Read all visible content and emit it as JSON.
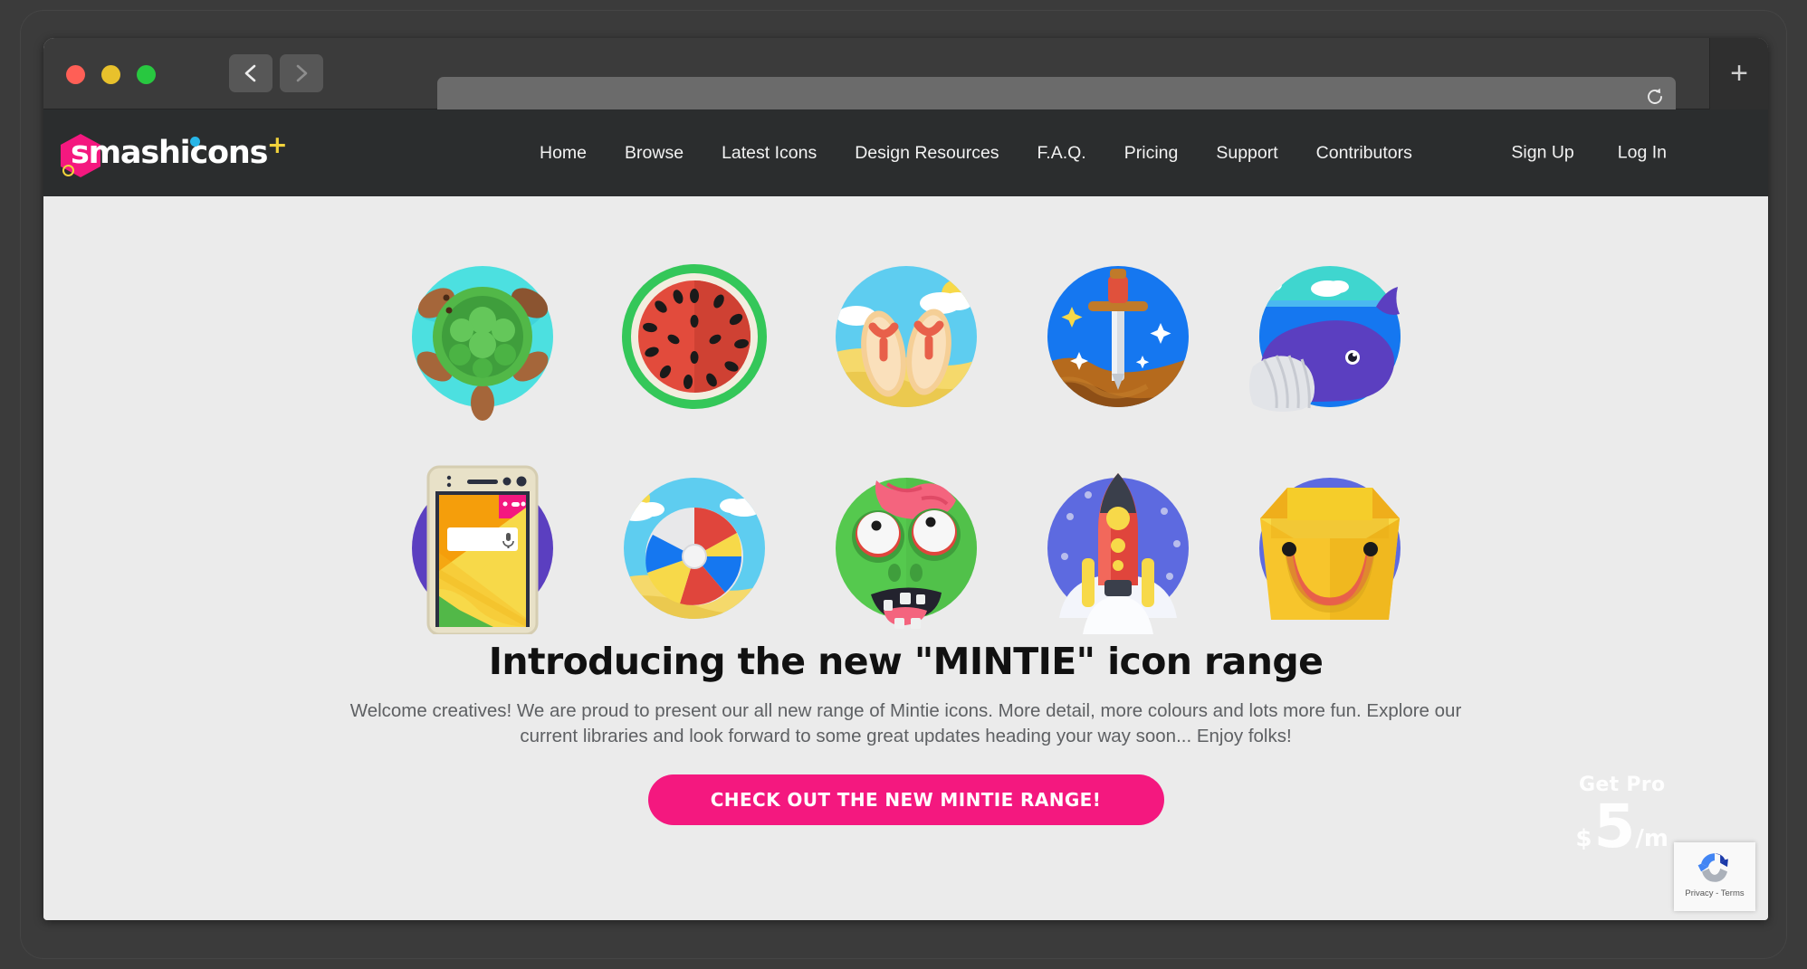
{
  "browser": {
    "traffic_lights": [
      {
        "name": "close",
        "color": "#ff5f56"
      },
      {
        "name": "minimize",
        "color": "#e8c12c"
      },
      {
        "name": "maximize",
        "color": "#28c840"
      }
    ],
    "back_icon": "chevron-left-icon",
    "forward_icon": "chevron-right-icon",
    "reload_icon": "reload-icon",
    "newtab_label": "+",
    "url_value": "",
    "url_placeholder": ""
  },
  "header": {
    "logo": {
      "word": "smashicons",
      "plus": "+"
    },
    "nav": [
      {
        "label": "Home"
      },
      {
        "label": "Browse"
      },
      {
        "label": "Latest Icons"
      },
      {
        "label": "Design Resources"
      },
      {
        "label": "F.A.Q."
      },
      {
        "label": "Pricing"
      },
      {
        "label": "Support"
      },
      {
        "label": "Contributors"
      }
    ],
    "auth": [
      {
        "label": "Sign Up"
      },
      {
        "label": "Log In"
      }
    ]
  },
  "icons": [
    {
      "name": "turtle-icon",
      "label": "Turtle"
    },
    {
      "name": "watermelon-icon",
      "label": "Watermelon"
    },
    {
      "name": "flip-flops-icon",
      "label": "Flip Flops"
    },
    {
      "name": "sword-icon",
      "label": "Sword in Stone"
    },
    {
      "name": "whale-icon",
      "label": "Whale"
    },
    {
      "name": "smartphone-icon",
      "label": "Smartphone"
    },
    {
      "name": "beach-ball-icon",
      "label": "Beach Ball"
    },
    {
      "name": "zombie-icon",
      "label": "Zombie"
    },
    {
      "name": "rocket-icon",
      "label": "Rocket"
    },
    {
      "name": "shopping-bag-icon",
      "label": "Shopping Bag"
    }
  ],
  "hero": {
    "title": "Introducing the new \"MINTIE\" icon range",
    "subtitle": "Welcome creatives! We are proud to present our all new range of Mintie icons. More detail, more colours and lots more fun. Explore our current libraries and look forward to some great updates heading your way soon... Enjoy folks!",
    "cta_label": "CHECK OUT THE NEW MINTIE RANGE!"
  },
  "get_pro": {
    "label": "Get Pro",
    "currency": "$",
    "amount": "5",
    "period": "/m"
  },
  "recaptcha": {
    "links": "Privacy - Terms",
    "logo_icon": "recaptcha-icon"
  },
  "colors": {
    "brand_pink": "#f4187f",
    "logo_yellow": "#f2d33c",
    "logo_cyan": "#27b6e8",
    "header_bg": "#2b2d2e",
    "page_bg": "#ebebeb",
    "toolbar_bg": "#3b3b3b"
  }
}
